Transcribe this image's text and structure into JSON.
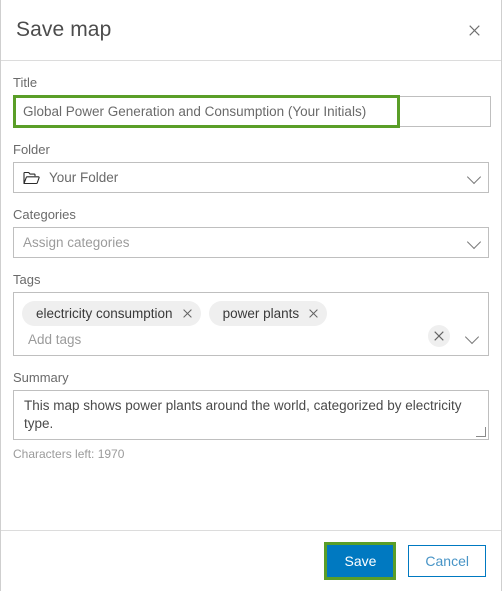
{
  "dialog": {
    "title": "Save map",
    "close_icon": "close-icon"
  },
  "form": {
    "title_field": {
      "label": "Title",
      "value": "Global Power Generation and Consumption (Your Initials)",
      "highlighted": true
    },
    "folder_field": {
      "label": "Folder",
      "value": "Your Folder",
      "icon": "folder-icon",
      "chevron": "chevron-down-icon"
    },
    "categories_field": {
      "label": "Categories",
      "placeholder": "Assign categories",
      "chevron": "chevron-down-icon"
    },
    "tags_field": {
      "label": "Tags",
      "chips": [
        {
          "label": "electricity consumption",
          "remove_icon": "close-icon"
        },
        {
          "label": "power plants",
          "remove_icon": "close-icon"
        }
      ],
      "placeholder": "Add tags",
      "clear_icon": "close-icon",
      "chevron": "chevron-down-icon"
    },
    "summary_field": {
      "label": "Summary",
      "value": "This map shows power plants around the world, categorized by electricity type.",
      "characters_left": "Characters left: 1970"
    }
  },
  "footer": {
    "save_label": "Save",
    "cancel_label": "Cancel",
    "save_highlighted": true
  },
  "colors": {
    "highlight_green": "#5a9e28",
    "primary_blue": "#0079c1",
    "cancel_blue": "#4894c6",
    "border_gray": "#bfbfbf",
    "chip_gray": "#efefef"
  }
}
